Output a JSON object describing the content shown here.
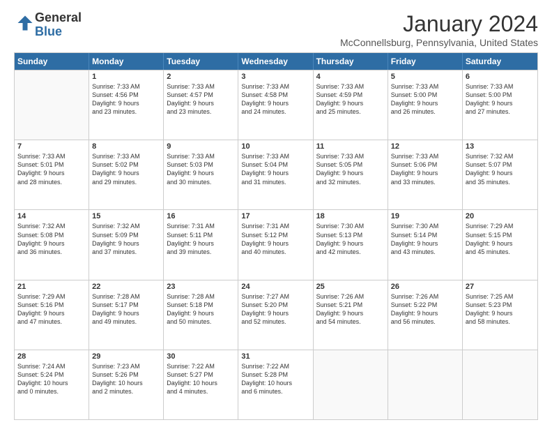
{
  "logo": {
    "general": "General",
    "blue": "Blue"
  },
  "title": "January 2024",
  "location": "McConnellsburg, Pennsylvania, United States",
  "days": [
    "Sunday",
    "Monday",
    "Tuesday",
    "Wednesday",
    "Thursday",
    "Friday",
    "Saturday"
  ],
  "rows": [
    [
      {
        "day": "",
        "lines": []
      },
      {
        "day": "1",
        "lines": [
          "Sunrise: 7:33 AM",
          "Sunset: 4:56 PM",
          "Daylight: 9 hours",
          "and 23 minutes."
        ]
      },
      {
        "day": "2",
        "lines": [
          "Sunrise: 7:33 AM",
          "Sunset: 4:57 PM",
          "Daylight: 9 hours",
          "and 23 minutes."
        ]
      },
      {
        "day": "3",
        "lines": [
          "Sunrise: 7:33 AM",
          "Sunset: 4:58 PM",
          "Daylight: 9 hours",
          "and 24 minutes."
        ]
      },
      {
        "day": "4",
        "lines": [
          "Sunrise: 7:33 AM",
          "Sunset: 4:59 PM",
          "Daylight: 9 hours",
          "and 25 minutes."
        ]
      },
      {
        "day": "5",
        "lines": [
          "Sunrise: 7:33 AM",
          "Sunset: 5:00 PM",
          "Daylight: 9 hours",
          "and 26 minutes."
        ]
      },
      {
        "day": "6",
        "lines": [
          "Sunrise: 7:33 AM",
          "Sunset: 5:00 PM",
          "Daylight: 9 hours",
          "and 27 minutes."
        ]
      }
    ],
    [
      {
        "day": "7",
        "lines": [
          "Sunrise: 7:33 AM",
          "Sunset: 5:01 PM",
          "Daylight: 9 hours",
          "and 28 minutes."
        ]
      },
      {
        "day": "8",
        "lines": [
          "Sunrise: 7:33 AM",
          "Sunset: 5:02 PM",
          "Daylight: 9 hours",
          "and 29 minutes."
        ]
      },
      {
        "day": "9",
        "lines": [
          "Sunrise: 7:33 AM",
          "Sunset: 5:03 PM",
          "Daylight: 9 hours",
          "and 30 minutes."
        ]
      },
      {
        "day": "10",
        "lines": [
          "Sunrise: 7:33 AM",
          "Sunset: 5:04 PM",
          "Daylight: 9 hours",
          "and 31 minutes."
        ]
      },
      {
        "day": "11",
        "lines": [
          "Sunrise: 7:33 AM",
          "Sunset: 5:05 PM",
          "Daylight: 9 hours",
          "and 32 minutes."
        ]
      },
      {
        "day": "12",
        "lines": [
          "Sunrise: 7:33 AM",
          "Sunset: 5:06 PM",
          "Daylight: 9 hours",
          "and 33 minutes."
        ]
      },
      {
        "day": "13",
        "lines": [
          "Sunrise: 7:32 AM",
          "Sunset: 5:07 PM",
          "Daylight: 9 hours",
          "and 35 minutes."
        ]
      }
    ],
    [
      {
        "day": "14",
        "lines": [
          "Sunrise: 7:32 AM",
          "Sunset: 5:08 PM",
          "Daylight: 9 hours",
          "and 36 minutes."
        ]
      },
      {
        "day": "15",
        "lines": [
          "Sunrise: 7:32 AM",
          "Sunset: 5:09 PM",
          "Daylight: 9 hours",
          "and 37 minutes."
        ]
      },
      {
        "day": "16",
        "lines": [
          "Sunrise: 7:31 AM",
          "Sunset: 5:11 PM",
          "Daylight: 9 hours",
          "and 39 minutes."
        ]
      },
      {
        "day": "17",
        "lines": [
          "Sunrise: 7:31 AM",
          "Sunset: 5:12 PM",
          "Daylight: 9 hours",
          "and 40 minutes."
        ]
      },
      {
        "day": "18",
        "lines": [
          "Sunrise: 7:30 AM",
          "Sunset: 5:13 PM",
          "Daylight: 9 hours",
          "and 42 minutes."
        ]
      },
      {
        "day": "19",
        "lines": [
          "Sunrise: 7:30 AM",
          "Sunset: 5:14 PM",
          "Daylight: 9 hours",
          "and 43 minutes."
        ]
      },
      {
        "day": "20",
        "lines": [
          "Sunrise: 7:29 AM",
          "Sunset: 5:15 PM",
          "Daylight: 9 hours",
          "and 45 minutes."
        ]
      }
    ],
    [
      {
        "day": "21",
        "lines": [
          "Sunrise: 7:29 AM",
          "Sunset: 5:16 PM",
          "Daylight: 9 hours",
          "and 47 minutes."
        ]
      },
      {
        "day": "22",
        "lines": [
          "Sunrise: 7:28 AM",
          "Sunset: 5:17 PM",
          "Daylight: 9 hours",
          "and 49 minutes."
        ]
      },
      {
        "day": "23",
        "lines": [
          "Sunrise: 7:28 AM",
          "Sunset: 5:18 PM",
          "Daylight: 9 hours",
          "and 50 minutes."
        ]
      },
      {
        "day": "24",
        "lines": [
          "Sunrise: 7:27 AM",
          "Sunset: 5:20 PM",
          "Daylight: 9 hours",
          "and 52 minutes."
        ]
      },
      {
        "day": "25",
        "lines": [
          "Sunrise: 7:26 AM",
          "Sunset: 5:21 PM",
          "Daylight: 9 hours",
          "and 54 minutes."
        ]
      },
      {
        "day": "26",
        "lines": [
          "Sunrise: 7:26 AM",
          "Sunset: 5:22 PM",
          "Daylight: 9 hours",
          "and 56 minutes."
        ]
      },
      {
        "day": "27",
        "lines": [
          "Sunrise: 7:25 AM",
          "Sunset: 5:23 PM",
          "Daylight: 9 hours",
          "and 58 minutes."
        ]
      }
    ],
    [
      {
        "day": "28",
        "lines": [
          "Sunrise: 7:24 AM",
          "Sunset: 5:24 PM",
          "Daylight: 10 hours",
          "and 0 minutes."
        ]
      },
      {
        "day": "29",
        "lines": [
          "Sunrise: 7:23 AM",
          "Sunset: 5:26 PM",
          "Daylight: 10 hours",
          "and 2 minutes."
        ]
      },
      {
        "day": "30",
        "lines": [
          "Sunrise: 7:22 AM",
          "Sunset: 5:27 PM",
          "Daylight: 10 hours",
          "and 4 minutes."
        ]
      },
      {
        "day": "31",
        "lines": [
          "Sunrise: 7:22 AM",
          "Sunset: 5:28 PM",
          "Daylight: 10 hours",
          "and 6 minutes."
        ]
      },
      {
        "day": "",
        "lines": []
      },
      {
        "day": "",
        "lines": []
      },
      {
        "day": "",
        "lines": []
      }
    ]
  ]
}
